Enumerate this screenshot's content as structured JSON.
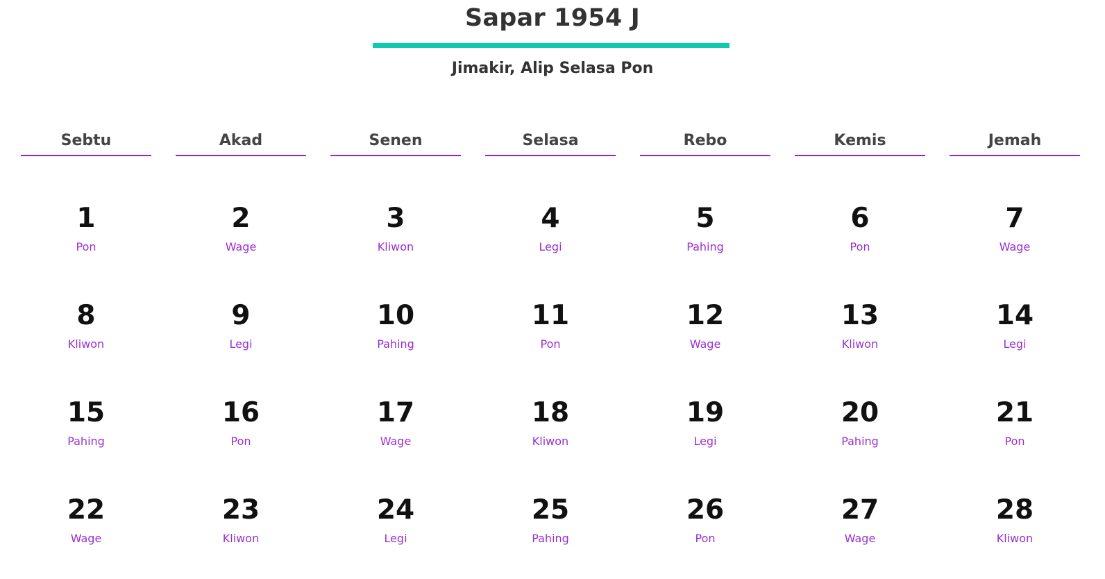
{
  "header": {
    "title": "Sapar 1954 J",
    "subtitle": "Jimakir, Alip Selasa Pon"
  },
  "colors": {
    "accent_bar": "#10c9b1",
    "weekday_underline": "#9b1fd6",
    "pasaran_text": "#9b2fd0"
  },
  "weekdays": [
    "Sebtu",
    "Akad",
    "Senen",
    "Selasa",
    "Rebo",
    "Kemis",
    "Jemah"
  ],
  "days": [
    {
      "num": "1",
      "pasaran": "Pon"
    },
    {
      "num": "2",
      "pasaran": "Wage"
    },
    {
      "num": "3",
      "pasaran": "Kliwon"
    },
    {
      "num": "4",
      "pasaran": "Legi"
    },
    {
      "num": "5",
      "pasaran": "Pahing"
    },
    {
      "num": "6",
      "pasaran": "Pon"
    },
    {
      "num": "7",
      "pasaran": "Wage"
    },
    {
      "num": "8",
      "pasaran": "Kliwon"
    },
    {
      "num": "9",
      "pasaran": "Legi"
    },
    {
      "num": "10",
      "pasaran": "Pahing"
    },
    {
      "num": "11",
      "pasaran": "Pon"
    },
    {
      "num": "12",
      "pasaran": "Wage"
    },
    {
      "num": "13",
      "pasaran": "Kliwon"
    },
    {
      "num": "14",
      "pasaran": "Legi"
    },
    {
      "num": "15",
      "pasaran": "Pahing"
    },
    {
      "num": "16",
      "pasaran": "Pon"
    },
    {
      "num": "17",
      "pasaran": "Wage"
    },
    {
      "num": "18",
      "pasaran": "Kliwon"
    },
    {
      "num": "19",
      "pasaran": "Legi"
    },
    {
      "num": "20",
      "pasaran": "Pahing"
    },
    {
      "num": "21",
      "pasaran": "Pon"
    },
    {
      "num": "22",
      "pasaran": "Wage"
    },
    {
      "num": "23",
      "pasaran": "Kliwon"
    },
    {
      "num": "24",
      "pasaran": "Legi"
    },
    {
      "num": "25",
      "pasaran": "Pahing"
    },
    {
      "num": "26",
      "pasaran": "Pon"
    },
    {
      "num": "27",
      "pasaran": "Wage"
    },
    {
      "num": "28",
      "pasaran": "Kliwon"
    }
  ]
}
